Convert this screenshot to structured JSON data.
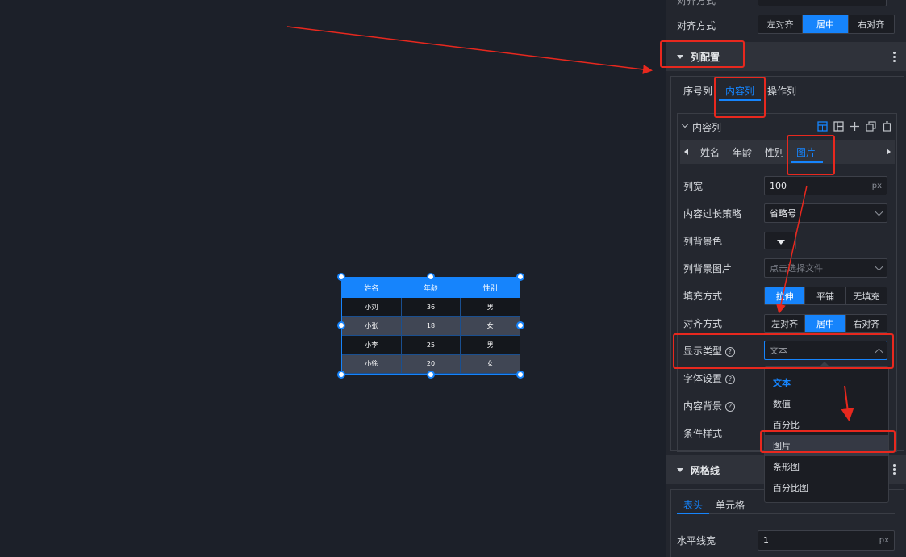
{
  "canvas_table": {
    "headers": [
      "姓名",
      "年龄",
      "性别"
    ],
    "rows": [
      [
        "小刘",
        "36",
        "男"
      ],
      [
        "小张",
        "18",
        "女"
      ],
      [
        "小李",
        "25",
        "男"
      ],
      [
        "小徐",
        "20",
        "女"
      ]
    ]
  },
  "top": {
    "cut_label": "对齐方式",
    "align_label": "对齐方式",
    "align_options": [
      "左对齐",
      "居中",
      "右对齐"
    ],
    "align_selected": "居中"
  },
  "column_section": {
    "title": "列配置",
    "tabs": [
      "序号列",
      "内容列",
      "操作列"
    ],
    "active_tab": "内容列",
    "panel_title": "内容列",
    "col_tabs": [
      "姓名",
      "年龄",
      "性别",
      "图片"
    ],
    "active_col_tab": "图片",
    "fields": {
      "width_label": "列宽",
      "width_value": "100",
      "width_unit": "px",
      "overflow_label": "内容过长策略",
      "overflow_value": "省略号",
      "bgcolor_label": "列背景色",
      "bgimage_label": "列背景图片",
      "bgimage_placeholder": "点击选择文件",
      "fill_label": "填充方式",
      "fill_options": [
        "拉伸",
        "平铺",
        "无填充"
      ],
      "fill_selected": "拉伸",
      "align_label": "对齐方式",
      "align_options": [
        "左对齐",
        "居中",
        "右对齐"
      ],
      "align_selected": "居中",
      "display_label": "显示类型",
      "display_value": "文本",
      "font_label": "字体设置",
      "content_bg_label": "内容背景",
      "cond_label": "条件样式"
    },
    "display_options": [
      "文本",
      "数值",
      "百分比",
      "图片",
      "条形图",
      "百分比图"
    ],
    "display_highlighted": "图片"
  },
  "grid_section": {
    "title": "网格线",
    "tabs": [
      "表头",
      "单元格"
    ],
    "active_tab": "表头",
    "hline_label": "水平线宽",
    "hline_value": "1",
    "hline_unit": "px"
  },
  "colors": {
    "accent": "#1684fc",
    "annotation": "#e8281e",
    "panel_bg": "#23262e",
    "canvas_bg": "#1c2029"
  }
}
